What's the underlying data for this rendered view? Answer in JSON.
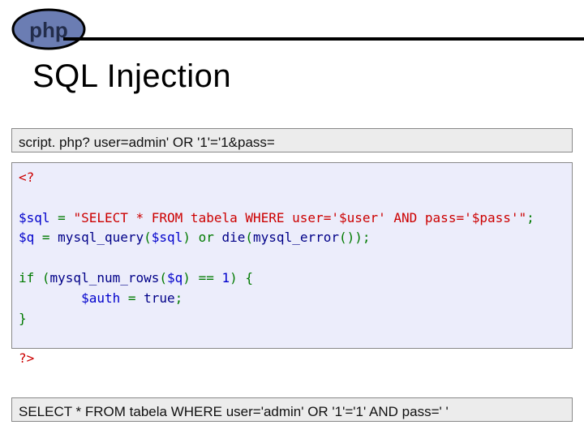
{
  "logo": {
    "text": "php"
  },
  "title": "SQL Injection",
  "band_top": "script. php? user=admin' OR '1'='1&pass=",
  "code": {
    "open": "<?",
    "var1": "$sql",
    "eq1": " = ",
    "str": "\"SELECT * FROM tabela WHERE user='$user' AND pass='$pass'\"",
    "semi1": ";",
    "var2": "$q",
    "eq2": " = ",
    "fn1": "mysql_query",
    "p1": "(",
    "arg1": "$sql",
    "p2": ") ",
    "or": "or",
    "sp": " ",
    "fn2": "die",
    "p3": "(",
    "fn3": "mysql_error",
    "p4": "())",
    "semi2": ";",
    "ifkw": "if",
    "ifcond_open": " (",
    "fn4": "mysql_num_rows",
    "p5": "(",
    "arg2": "$q",
    "p6": ") ",
    "eqop": "==",
    "num": " 1",
    "ifcond_close": ") {",
    "indent": "        ",
    "var3": "$auth",
    "eq3": " = ",
    "true": "true",
    "semi3": ";",
    "brace_close": "}",
    "close": "?>"
  },
  "band_bottom": "SELECT * FROM tabela WHERE user='admin' OR '1'='1' AND pass=' '"
}
